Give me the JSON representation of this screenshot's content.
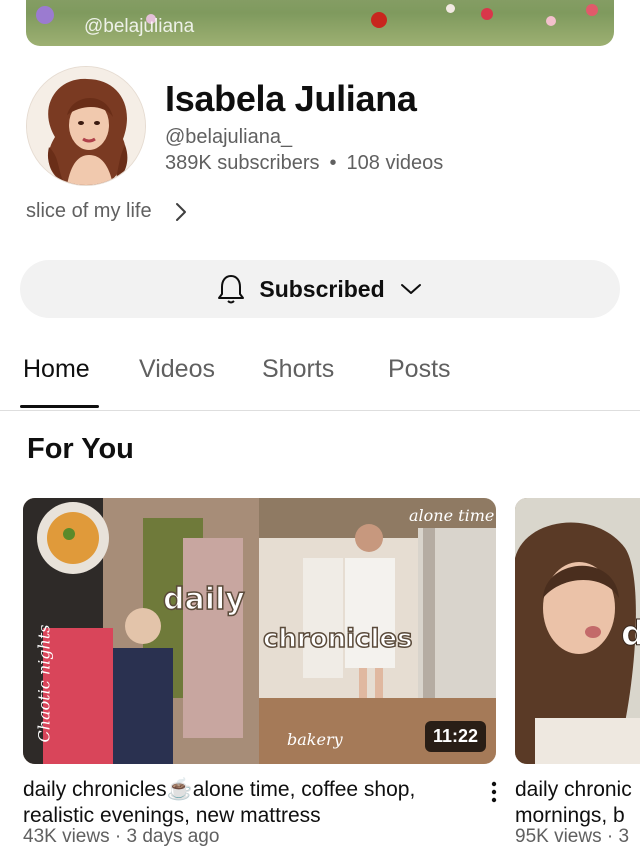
{
  "banner": {
    "handle": "@belajuliana"
  },
  "channel": {
    "name": "Isabela Juliana",
    "handle": "@belajuliana_",
    "subscribers": "389K subscribers",
    "separator": "•",
    "videos": "108 videos",
    "about": "slice of my life"
  },
  "subscribe": {
    "label": "Subscribed"
  },
  "tabs": [
    {
      "label": "Home",
      "active": true
    },
    {
      "label": "Videos",
      "active": false
    },
    {
      "label": "Shorts",
      "active": false
    },
    {
      "label": "Posts",
      "active": false
    }
  ],
  "section": {
    "title": "For You"
  },
  "videos": [
    {
      "title": "daily chronicles☕️alone time, coffee shop, realistic evenings, new mattress",
      "meta": "43K views · 3 days ago",
      "duration": "11:22",
      "overlay": {
        "daily": "daily",
        "chronicles": "chronicles",
        "tag_left": "Chaotic nights",
        "tag_top": "alone time",
        "tag_bottom": "bakery"
      }
    },
    {
      "title": "daily chronic mornings, b",
      "title_line1": "daily chronic",
      "title_line2": "mornings, b",
      "meta": "95K views · 3",
      "overlay": {
        "letter": "d"
      }
    }
  ],
  "colors": {
    "accent": "#0f0f0f",
    "secondary_text": "#606060",
    "button_bg": "#f2f2f2"
  },
  "icons": {
    "bell": "bell-icon",
    "chevron_down": "chevron-down-icon",
    "chevron_right": "chevron-right-icon",
    "more": "more-vert-icon"
  }
}
